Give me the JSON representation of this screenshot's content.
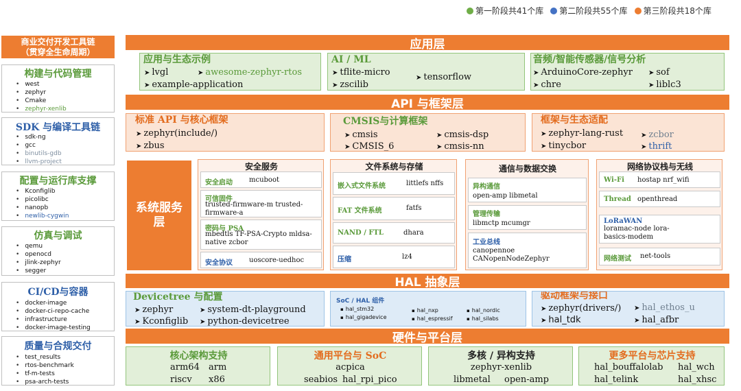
{
  "legend": [
    {
      "label": "第一阶段共41个库",
      "color": "#6fad47"
    },
    {
      "label": "第二阶段共55个库",
      "color": "#4472c4"
    },
    {
      "label": "第三阶段共18个库",
      "color": "#ed7d31"
    }
  ],
  "sidebar": {
    "header": [
      "商业交付开发工具链",
      "（贯穿全生命周期）"
    ],
    "groups": [
      {
        "title": "构建与代码管理",
        "items": [
          "west",
          "zephyr",
          "Cmake",
          "zephyr-xenlib"
        ]
      },
      {
        "title": "SDK 与编译工具链",
        "items": [
          "sdk-ng",
          "gcc",
          "binutils-gdb",
          "llvm-project"
        ]
      },
      {
        "title": "配置与运行库支撑",
        "items": [
          "Kconfiglib",
          "picolibc",
          "nanopb",
          "newlib-cygwin"
        ]
      },
      {
        "title": "仿真与调试",
        "items": [
          "qemu",
          "openocd",
          "jlink-zephyr",
          "segger"
        ]
      },
      {
        "title": "CI/CD与容器",
        "items": [
          "docker-image",
          "docker-ci-repo-cache",
          "infrastructure",
          "docker-image-testing"
        ]
      },
      {
        "title": "质量与合规交付",
        "items": [
          "test_results",
          "rtos-benchmark",
          "tf-m-tests",
          "psa-arch-tests"
        ]
      }
    ]
  },
  "app": {
    "banner": "应用层",
    "boxes": [
      {
        "title": "应用与生态示例",
        "items": [
          "lvgl",
          "awesome-zephyr-rtos",
          "example-application"
        ]
      },
      {
        "title": "AI / ML",
        "items": [
          "tflite-micro",
          "zscilib",
          "tensorflow"
        ]
      },
      {
        "title": "音频/智能传感器/信号分析",
        "items": [
          "ArduinoCore-zephyr",
          "chre",
          "sof",
          "liblc3"
        ]
      }
    ]
  },
  "api": {
    "banner": "API 与框架层",
    "boxes": [
      {
        "title": "标准 API 与核心框架",
        "items": [
          "zephyr(include/)",
          "zbus"
        ]
      },
      {
        "title": "CMSIS与计算框架",
        "items": [
          "cmsis",
          "CMSIS_6",
          "cmsis-dsp",
          "cmsis-nn"
        ]
      },
      {
        "title": "框架与生态适配",
        "items": [
          "zephyr-lang-rust",
          "tinycbor",
          "zcbor",
          "thrift"
        ]
      }
    ]
  },
  "sys": {
    "label": "系统服务层",
    "columns": [
      {
        "title": "安全服务",
        "rows": [
          {
            "label": "安全启动",
            "value": "mcuboot"
          },
          {
            "label": "可信固件",
            "value": "trusted-firmware-m  trusted-firmware-a"
          },
          {
            "label": "密码与 PSA",
            "value": "mbedtls  TF-PSA-Crypto  mldsa-native  zcbor"
          },
          {
            "label": "安全协议",
            "value": "uoscore-uedhoc"
          }
        ]
      },
      {
        "title": "文件系统与存储",
        "rows": [
          {
            "label": "嵌入式文件系统",
            "value": "littlefs  nffs"
          },
          {
            "label": "FAT 文件系统",
            "value": "fatfs"
          },
          {
            "label": "NAND / FTL",
            "value": "dhara"
          },
          {
            "label": "压缩",
            "value": "lz4"
          }
        ]
      },
      {
        "title": "通信与数据交换",
        "rows": [
          {
            "label": "异构通信",
            "value": "open-amp   libmetal"
          },
          {
            "label": "管理传输",
            "value": "libmctp        mcumgr"
          },
          {
            "label": "工业总线",
            "value": "canopennoe  CANopenNodeZephyr"
          }
        ]
      },
      {
        "title": "网络协议栈与无线",
        "rows": [
          {
            "label": "Wi-Fi",
            "value": "hostap    nrf_wifi"
          },
          {
            "label": "Thread",
            "value": "openthread"
          },
          {
            "label": "LoRaWAN",
            "value": "loramac-node  lora-basics-modem"
          },
          {
            "label": "网络测试",
            "value": "net-tools"
          }
        ]
      }
    ]
  },
  "hal": {
    "banner": "HAL 抽象层",
    "boxes": [
      {
        "title": "Devicetree 与配置",
        "items": [
          "zephyr",
          "Kconfiglib",
          "system-dt-playground",
          "python-devicetree"
        ]
      },
      {
        "title": "SoC / HAL 组件",
        "items": [
          "hal_stm32",
          "hal_gigadevice",
          "hal_nxp",
          "hal_espressif",
          "hal_nordic",
          "hal_silabs"
        ]
      },
      {
        "title": "驱动框架与接口",
        "items": [
          "zephyr(drivers/)",
          "hal_tdk",
          "hal_ethos_u",
          "hal_afbr"
        ]
      }
    ]
  },
  "hw": {
    "banner": "硬件与平台层",
    "boxes": [
      {
        "title": "核心架构支持",
        "items": [
          "arm64",
          "arm",
          "riscv",
          "x86"
        ]
      },
      {
        "title": "通用平台与 SoC",
        "items": [
          "acpica",
          "seabios",
          "hal_rpi_pico"
        ]
      },
      {
        "title": "多核 / 异构支持",
        "items": [
          "zephyr-xenlib",
          "libmetal",
          "open-amp"
        ]
      },
      {
        "title": "更多平台与芯片支持",
        "items": [
          "hal_bouffalolab",
          "hal_wch",
          "hal_telink",
          "hal_xhsc"
        ]
      }
    ]
  }
}
